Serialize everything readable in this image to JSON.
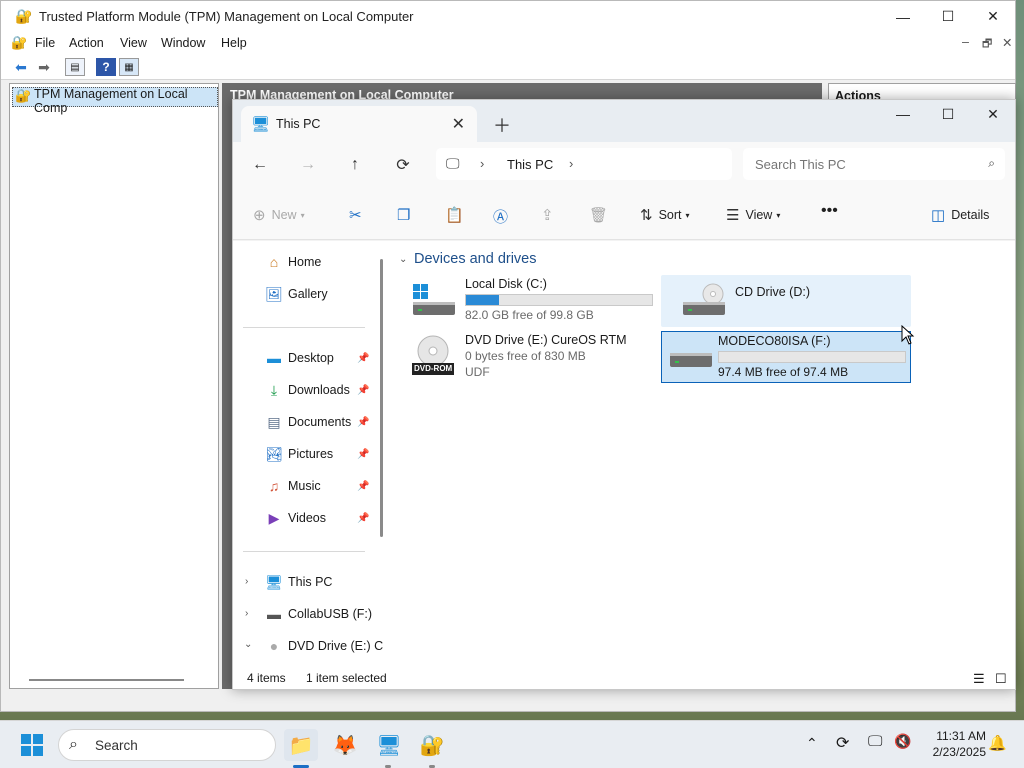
{
  "mmc": {
    "title": "Trusted Platform Module (TPM) Management on Local Computer",
    "menu": [
      "File",
      "Action",
      "View",
      "Window",
      "Help"
    ],
    "tree_item": "TPM Management on Local Comp",
    "center_header": "TPM Management on Local Computer",
    "actions_header": "Actions"
  },
  "explorer": {
    "tab_title": "This PC",
    "breadcrumb": "This PC",
    "search_placeholder": "Search This PC",
    "commands": {
      "new": "New",
      "sort": "Sort",
      "view": "View",
      "details": "Details"
    },
    "nav": {
      "home": "Home",
      "gallery": "Gallery",
      "pinned": [
        "Desktop",
        "Downloads",
        "Documents",
        "Pictures",
        "Music",
        "Videos"
      ],
      "this_pc": "This PC",
      "collabusb": "CollabUSB (F:)",
      "dvd": "DVD Drive (E:) C"
    },
    "group_header": "Devices and drives",
    "drives": [
      {
        "name": "Local Disk (C:)",
        "free": "82.0 GB free of 99.8 GB",
        "used_fraction": 0.18
      },
      {
        "name": "CD Drive (D:)"
      },
      {
        "name": "DVD Drive (E:) CureOS RTM",
        "free": "0 bytes free of 830 MB",
        "fs": "UDF",
        "badge": "DVD-ROM"
      },
      {
        "name": "MODECO80ISA (F:)",
        "free": "97.4 MB free of 97.4 MB",
        "used_fraction": 0.0
      }
    ],
    "status": {
      "items": "4 items",
      "selected": "1 item selected"
    }
  },
  "taskbar": {
    "search": "Search",
    "time": "11:31 AM",
    "date": "2/23/2025"
  },
  "colors": {
    "accent": "#2a8ad6",
    "selection": "#cce4f7",
    "selection_border": "#0a62b8"
  }
}
